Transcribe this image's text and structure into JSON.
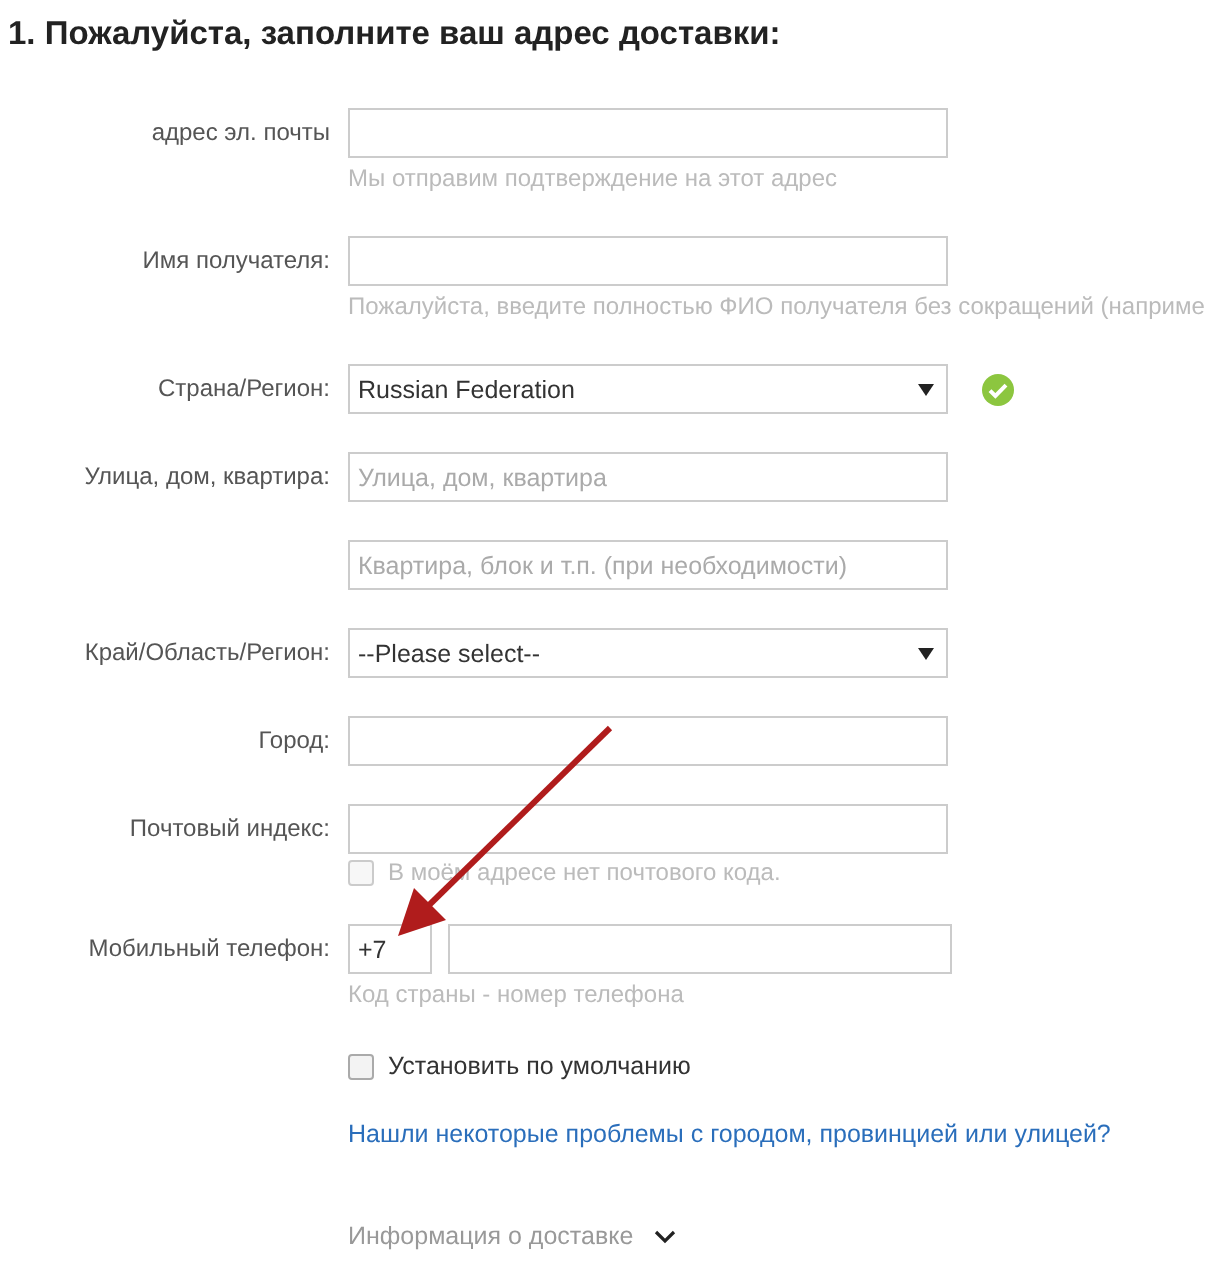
{
  "heading": "1. Пожалуйста, заполните ваш адрес доставки:",
  "fields": [
    {
      "kind": "text",
      "label": "адрес эл. почты",
      "hint": "Мы отправим подтверждение на этот адрес"
    },
    {
      "kind": "text",
      "label": "Имя получателя:",
      "hint": "Пожалуйста, введите полностью ФИО получателя без сокращений (наприме"
    },
    {
      "kind": "select",
      "label": "Страна/Регион:",
      "value": "Russian Federation",
      "valid": true
    },
    {
      "kind": "text",
      "label": "Улица, дом, квартира:",
      "placeholder": "Улица, дом, квартира"
    },
    {
      "kind": "text",
      "placeholder": "Квартира, блок и т.п. (при необходимости)"
    },
    {
      "kind": "select",
      "label": "Край/Область/Регион:",
      "value": "--Please select--"
    },
    {
      "kind": "text",
      "label": "Город:"
    },
    {
      "kind": "text",
      "label": "Почтовый индекс:",
      "checkbox": {
        "label": "В моём адресе нет почтового кода.",
        "checked": false,
        "disabled": true
      }
    },
    {
      "kind": "phone",
      "label": "Мобильный телефон:",
      "code": "+7",
      "hint": "Код страны - номер телефона"
    }
  ],
  "default_checkbox": {
    "label": "Установить по умолчанию",
    "checked": false
  },
  "problem_link": "Нашли некоторые проблемы с городом, провинцией или улицей?",
  "delivery_info": {
    "label": "Информация о доставке",
    "expanded": false
  }
}
